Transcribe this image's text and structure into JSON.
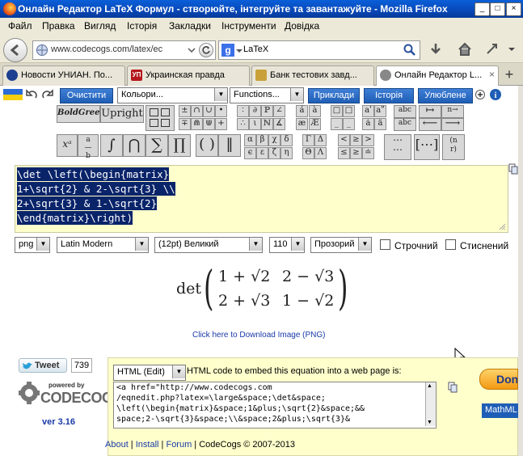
{
  "window": {
    "title": "Онлайн Редактор LaTeX Формул - створюйте, інтегруйте та завантажуйте - Mozilla Firefox",
    "controls": [
      "_",
      "□",
      "×"
    ]
  },
  "menu": [
    "Файл",
    "Правка",
    "Вигляд",
    "Історія",
    "Закладки",
    "Інструменти",
    "Довідка"
  ],
  "nav": {
    "url": "www.codecogs.com/latex/ec",
    "search_engine": "g",
    "search_value": "LaTeX"
  },
  "tabs": [
    {
      "label": "Новости УНИАН. По...",
      "fav_color": "#1d3f8f"
    },
    {
      "label": "Украинская правда",
      "fav_color": "#b5171c",
      "fav_text": "УП"
    },
    {
      "label": "Банк тестових завд...",
      "fav_color": "#c8a13a"
    },
    {
      "label": "Онлайн Редактор L...",
      "fav_color": "#888888",
      "active": true
    }
  ],
  "toolbar": {
    "clear": "Очистити",
    "colors": "Кольори...",
    "functions": "Functions...",
    "examples": "Приклади",
    "history": "Історія",
    "favorites": "Улюблене"
  },
  "palette": {
    "bold_green": "BoldGreen",
    "upright": "Upright"
  },
  "editor": {
    "lines": [
      "\\det \\left(\\begin{matrix}",
      "1+\\sqrt{2} & 2-\\sqrt{3} \\\\",
      "2+\\sqrt{3} & 1-\\sqrt{2}",
      "\\end{matrix}\\right)"
    ]
  },
  "options": {
    "format": "png",
    "font": "Latin Modern",
    "size": "(12pt) Великий",
    "dpi": "110",
    "background": "Прозорий",
    "inline_label": "Строчний",
    "compressed_label": "Стиснений"
  },
  "formula": {
    "det": "det",
    "a11": "1 + √2",
    "a12": "2 − √3",
    "a21": "2 + √3",
    "a22": "1 − √2"
  },
  "download_link": "Click here to Download Image (PNG)",
  "social": {
    "tweet": "Tweet",
    "count": "739"
  },
  "logo": {
    "powered": "powered by",
    "name": "CODECOGS",
    "version": "ver 3.16"
  },
  "embed": {
    "mode": "HTML (Edit)",
    "label": "HTML code to embed this equation into a web page is:",
    "code": [
      "<a href=\"http://www.codecogs.com",
      "/eqnedit.php?latex=\\large&space;\\det&space;",
      "\\left(\\begin{matrix}&space;1&plus;\\sqrt{2}&space;&&",
      "space;2-\\sqrt{3}&space;\\\\&space;2&plus;\\sqrt{3}&"
    ],
    "side_btn": "Don",
    "mathml": "MathML"
  },
  "footer": {
    "about": "About",
    "install": "Install",
    "forum": "Forum",
    "copyright": "CodeCogs © 2007-2013"
  },
  "colors": {
    "title_bar": "#0848b8",
    "accent_blue": "#1f5eb6",
    "editor_bg": "#ffffcc",
    "selection": "#0a246a",
    "link": "#1a3aa8"
  }
}
